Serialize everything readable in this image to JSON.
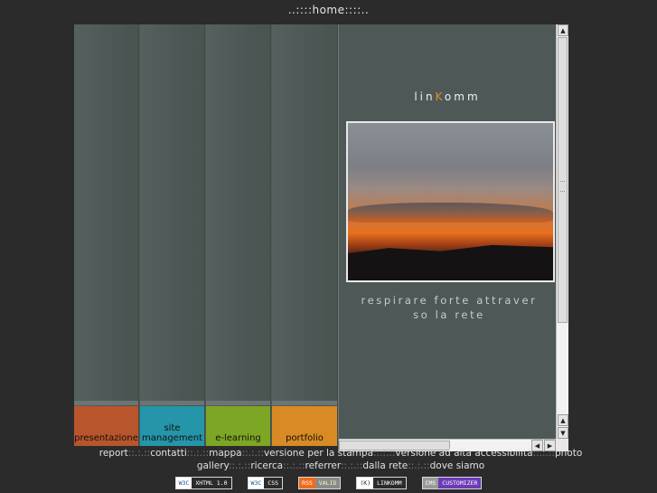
{
  "header": {
    "title": "..::::home::::.."
  },
  "nav": {
    "tabs": [
      {
        "label": "presentazione",
        "color": "#b9552c"
      },
      {
        "label": "site management",
        "color": "#2595a9"
      },
      {
        "label": "e-learning",
        "color": "#7da624"
      },
      {
        "label": "portfolio",
        "color": "#d88a24"
      }
    ]
  },
  "content": {
    "logo_pre": "lin",
    "logo_k": "K",
    "logo_post": "omm",
    "tagline_line1": "respirare forte attraver",
    "tagline_line2": "so la rete"
  },
  "footer": {
    "row1": [
      "report",
      "contatti",
      "mappa",
      "versione per la stampa",
      "versione ad alta accessibilità",
      "photo"
    ],
    "row2": [
      "gallery",
      "ricerca",
      "referrer",
      "dalla rete",
      "dove siamo"
    ],
    "separator": "::.:.::"
  },
  "badges": [
    {
      "left": "W3C",
      "right": "XHTML 1.0",
      "left_color": "#ffffff",
      "left_text": "#1a4d8f"
    },
    {
      "left": "W3C",
      "right": "CSS",
      "left_color": "#ffffff",
      "left_text": "#1a4d8f"
    },
    {
      "left": "RSS",
      "right": "VALID",
      "left_color": "#f26a1b",
      "left_text": "#ffffff"
    },
    {
      "left": "(K)",
      "right": "LINKOMM",
      "left_color": "#ffffff",
      "left_text": "#222222"
    },
    {
      "left": "CMS",
      "right": "CUSTOMIZER",
      "left_color": "#9a9a9a",
      "left_text": "#ffffff"
    }
  ]
}
